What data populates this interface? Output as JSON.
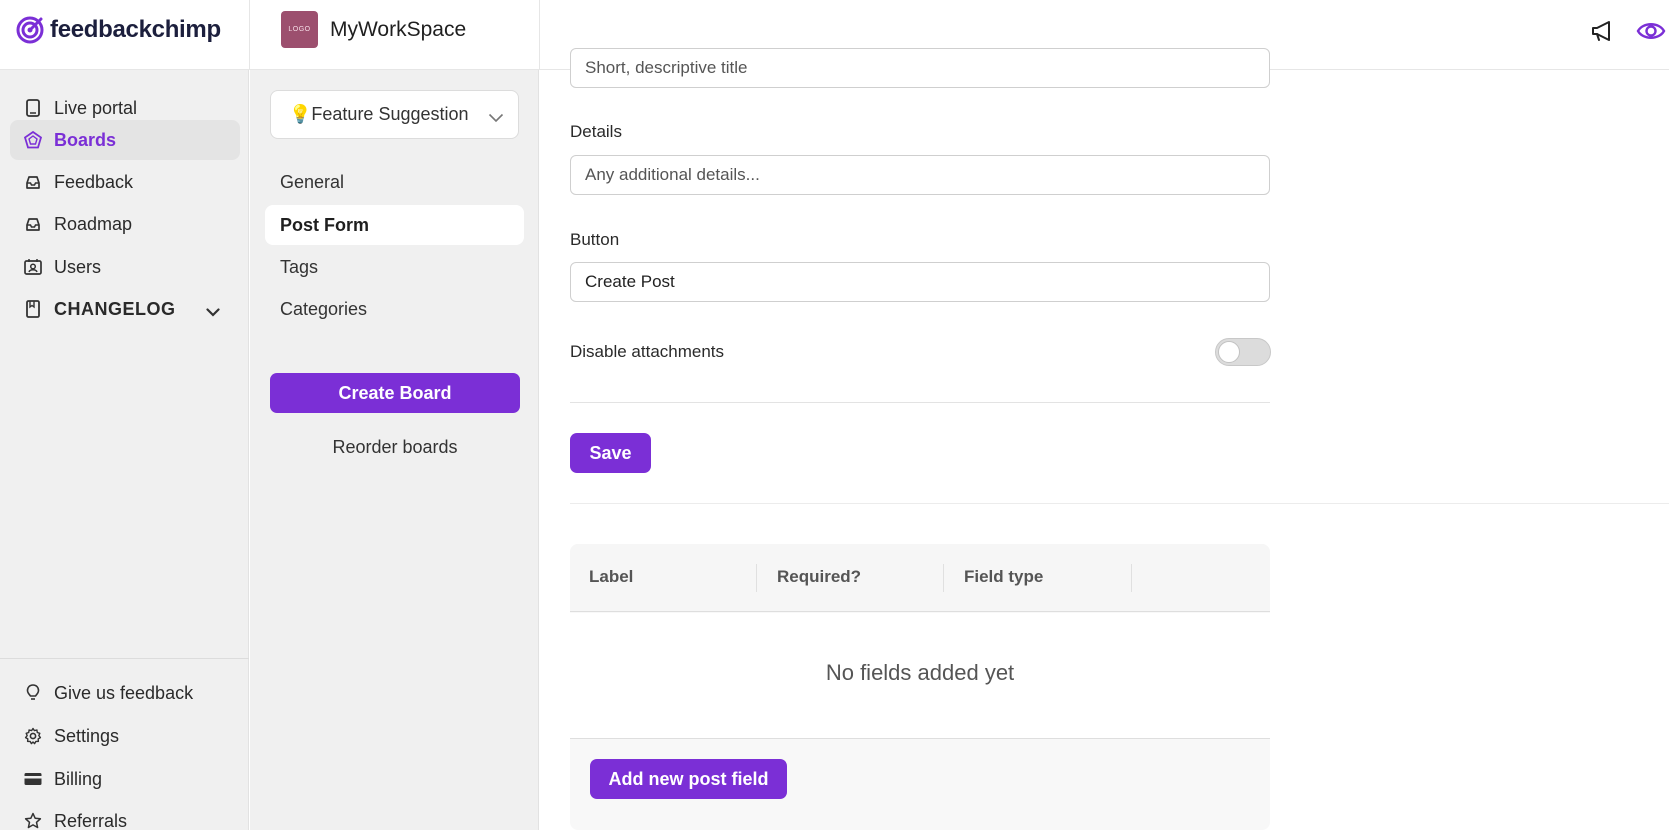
{
  "brand": {
    "name": "feedbackchimp",
    "accent": "#7b2fd6"
  },
  "workspace": {
    "logo_text": "LOGO",
    "name": "MyWorkSpace"
  },
  "topbar_icons": [
    "megaphone-icon",
    "eye-icon"
  ],
  "sidebar": {
    "items": [
      {
        "label": "Live portal",
        "icon": "page-icon"
      },
      {
        "label": "Boards",
        "icon": "boards-icon",
        "active": true
      },
      {
        "label": "Feedback",
        "icon": "inbox-icon"
      },
      {
        "label": "Roadmap",
        "icon": "inbox-icon"
      },
      {
        "label": "Users",
        "icon": "users-icon"
      },
      {
        "label": "CHANGELOG",
        "icon": "changelog-icon"
      }
    ],
    "bottom_items": [
      {
        "label": "Give us feedback",
        "icon": "lightbulb-icon"
      },
      {
        "label": "Settings",
        "icon": "gear-icon"
      },
      {
        "label": "Billing",
        "icon": "card-icon"
      },
      {
        "label": "Referrals",
        "icon": "star-icon"
      }
    ]
  },
  "boards_panel": {
    "selected_board": "💡Feature Suggestion",
    "sections": [
      {
        "label": "General"
      },
      {
        "label": "Post Form",
        "active": true
      },
      {
        "label": "Tags"
      },
      {
        "label": "Categories"
      }
    ],
    "create_board_label": "Create Board",
    "reorder_label": "Reorder boards"
  },
  "post_form": {
    "title_placeholder": "Short, descriptive title",
    "details_label": "Details",
    "details_placeholder": "Any additional details...",
    "button_label": "Button",
    "button_value": "Create Post",
    "disable_attachments_label": "Disable attachments",
    "disable_attachments_on": false,
    "save_label": "Save"
  },
  "fields_table": {
    "columns": [
      "Label",
      "Required?",
      "Field type"
    ],
    "empty_text": "No fields added yet",
    "add_label": "Add new post field"
  }
}
